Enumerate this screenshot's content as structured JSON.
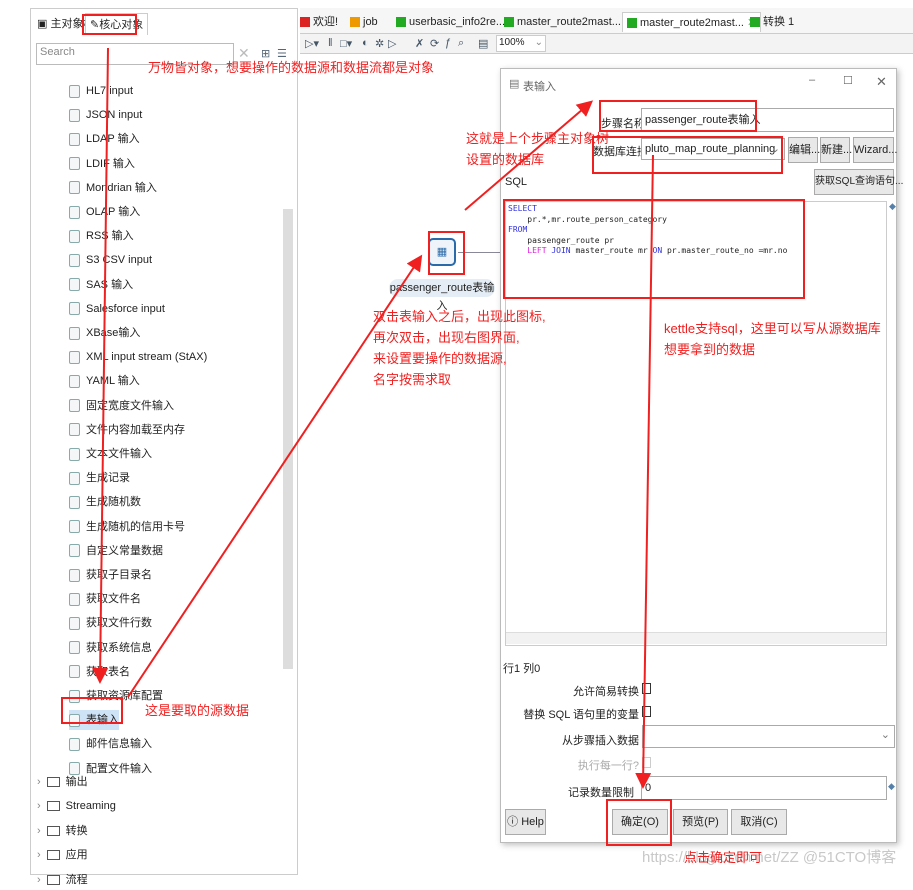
{
  "left_panel": {
    "tabs": [
      "主对象树",
      "核心对象"
    ],
    "search_placeholder": "Search",
    "items": [
      "HL7 input",
      "JSON input",
      "LDAP 输入",
      "LDIF 输入",
      "Mondrian 输入",
      "OLAP 输入",
      "RSS 输入",
      "S3 CSV input",
      "SAS 输入",
      "Salesforce input",
      "XBase输入",
      "XML input stream (StAX)",
      "YAML 输入",
      "固定宽度文件输入",
      "文件内容加载至内存",
      "文本文件输入",
      "生成记录",
      "生成随机数",
      "生成随机的信用卡号",
      "自定义常量数据",
      "获取子目录名",
      "获取文件名",
      "获取文件行数",
      "获取系统信息",
      "获取表名",
      "获取资源库配置",
      "表输入",
      "邮件信息输入",
      "配置文件输入"
    ],
    "selected_item": "表输入",
    "folders": [
      "输出",
      "Streaming",
      "转换",
      "应用",
      "流程"
    ]
  },
  "editor_tabs": [
    "欢迎!",
    "job",
    "userbasic_info2re...",
    "master_route2mast...",
    "master_route2mast...",
    "转换 1"
  ],
  "active_tab_index": 4,
  "toolbar": {
    "zoom": "100%"
  },
  "canvas": {
    "step_label": "passenger_route表输入"
  },
  "dialog": {
    "title": "表输入",
    "step_name_label": "步骤名称",
    "step_name_value": "passenger_route表输入",
    "db_conn_label": "数据库连接",
    "db_conn_value": "pluto_map_route_planning",
    "edit_btn": "编辑...",
    "new_btn": "新建...",
    "wizard_btn": "Wizard...",
    "get_sql_btn": "获取SQL查询语句...",
    "sql_label": "SQL",
    "sql": {
      "l1": "SELECT",
      "l2": "    pr.*,mr.route_person_category",
      "l3": "FROM",
      "l4": "    passenger_route pr",
      "l5a": "LEFT",
      "l5b": "JOIN",
      "l5c": " master_route mr ",
      "l5d": "ON",
      "l5e": " pr.master_route_no =mr.no"
    },
    "cursor_pos": "行1 列0",
    "lazy_conv_label": "允许简易转换",
    "replace_vars_label": "替换 SQL 语句里的变量",
    "insert_from_label": "从步骤插入数据",
    "exec_each_row_label": "执行每一行?",
    "limit_label": "记录数量限制",
    "limit_value": "0",
    "help_btn": "Help",
    "ok_btn": "确定(O)",
    "preview_btn": "预览(P)",
    "cancel_btn": "取消(C)"
  },
  "annotations": {
    "a1": "万物皆对象，想要操作的数据源和数据流都是对象",
    "a2_1": "这就是上个步骤主对象树",
    "a2_2": "设置的数据库",
    "a3_1": "双击表输入之后，出现此图标,",
    "a3_2": "再次双击，出现右图界面,",
    "a3_3": "来设置要操作的数据源,",
    "a3_4": "名字按需求取",
    "a4_1": "kettle支持sql，这里可以写从源数据库",
    "a4_2": "想要拿到的数据",
    "a5": "这是要取的源数据",
    "a6": "点击确定即可",
    "color": "#f02020"
  },
  "watermark": "https://blog.csdn.net/ZZ @51CTO博客"
}
